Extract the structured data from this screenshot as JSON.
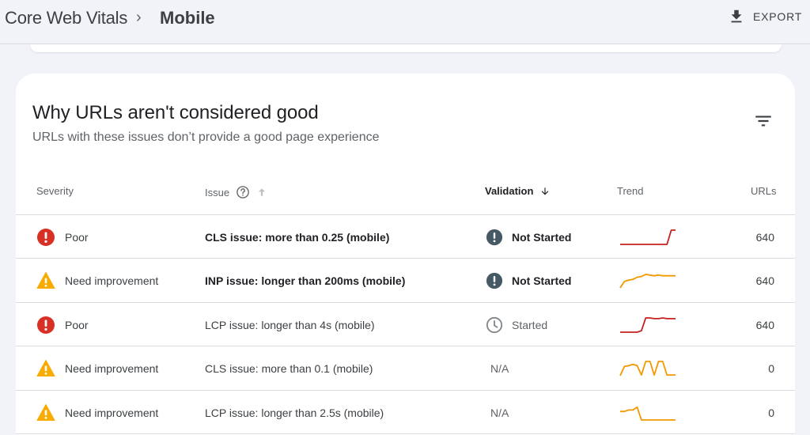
{
  "header": {
    "breadcrumb_root": "Core Web Vitals",
    "breadcrumb_separator": "›",
    "breadcrumb_current": "Mobile",
    "export_label": "EXPORT"
  },
  "card": {
    "title": "Why URLs aren't considered good",
    "subtitle": "URLs with these issues don’t provide a good page experience"
  },
  "table": {
    "columns": {
      "severity": "Severity",
      "issue": "Issue",
      "validation": "Validation",
      "trend": "Trend",
      "urls": "URLs"
    },
    "rows": [
      {
        "severity": "Poor",
        "severity_icon": "error-icon",
        "issue": "CLS issue: more than 0.25 (mobile)",
        "validation": "Not Started",
        "validation_icon": "alert-circle-icon",
        "urls": "640",
        "trend_color": "#c5221f",
        "trend": [
          0,
          0,
          0,
          0,
          0,
          0,
          0,
          0,
          0,
          0,
          0,
          0,
          1,
          1
        ]
      },
      {
        "severity": "Need improvement",
        "severity_icon": "warning-icon",
        "issue": "INP issue: longer than 200ms (mobile)",
        "validation": "Not Started",
        "validation_icon": "alert-circle-icon",
        "urls": "640",
        "trend_color": "#f29900",
        "trend": [
          0,
          0.45,
          0.55,
          0.6,
          0.75,
          0.8,
          0.95,
          0.9,
          0.85,
          0.9,
          0.85,
          0.85,
          0.85,
          0.85
        ]
      },
      {
        "severity": "Poor",
        "severity_icon": "error-icon",
        "issue": "LCP issue: longer than 4s (mobile)",
        "validation": "Started",
        "validation_icon": "clock-icon",
        "urls": "640",
        "trend_color": "#c5221f",
        "trend": [
          0,
          0,
          0,
          0,
          0,
          0.1,
          1,
          1,
          0.95,
          0.95,
          1,
          0.95,
          0.95,
          0.95
        ]
      },
      {
        "severity": "Need improvement",
        "severity_icon": "warning-icon",
        "issue": "CLS issue: more than 0.1 (mobile)",
        "validation": "N/A",
        "validation_icon": "",
        "urls": "0",
        "trend_color": "#f29900",
        "trend": [
          0,
          0.65,
          0.7,
          0.8,
          0.7,
          0.05,
          1,
          1,
          0.05,
          1,
          1,
          0.05,
          0.05,
          0.05
        ]
      },
      {
        "severity": "Need improvement",
        "severity_icon": "warning-icon",
        "issue": "LCP issue: longer than 2.5s (mobile)",
        "validation": "N/A",
        "validation_icon": "",
        "urls": "0",
        "trend_color": "#f29900",
        "trend": [
          0.6,
          0.6,
          0.7,
          0.7,
          0.9,
          0,
          0,
          0,
          0,
          0,
          0,
          0,
          0,
          0
        ]
      }
    ]
  },
  "colors": {
    "poor": "#d93025",
    "warning": "#f9ab00",
    "not_started": "#455a64",
    "started": "#80868b"
  }
}
